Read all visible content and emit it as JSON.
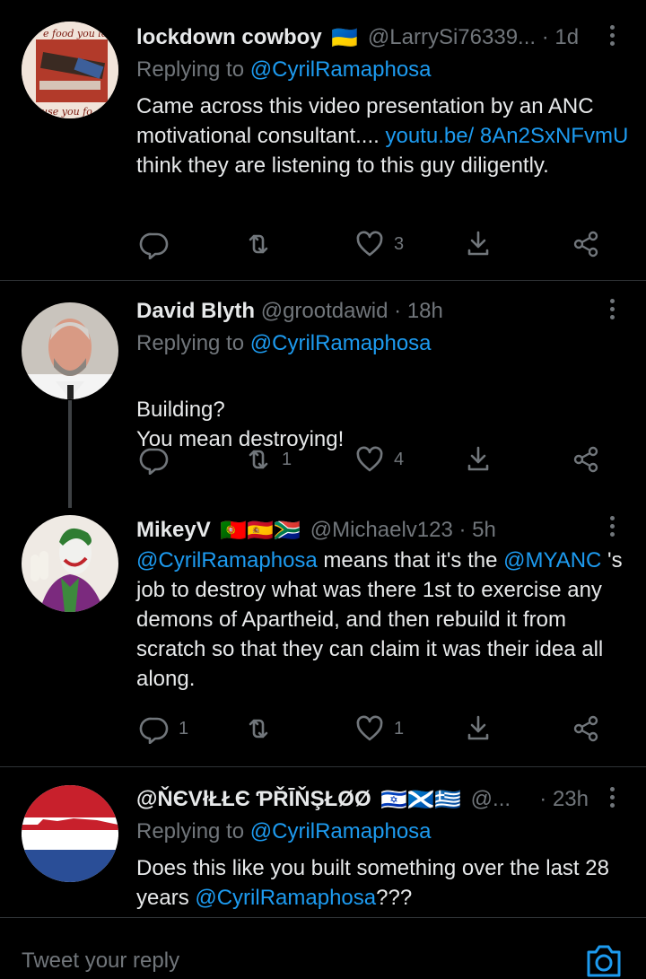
{
  "tweets": [
    {
      "name": "lockdown cowboy",
      "flags": "🇺🇦",
      "handle": "@LarrySi76339...",
      "time": "· 1d",
      "reply_prefix": "Replying to",
      "reply_to": "@CyrilRamaphosa",
      "text": [
        {
          "t": "Came across this video presentation by an ANC motivational consultant.... ",
          "link": false
        },
        {
          "t": "youtu.be/ 8An2SxNFvmU",
          "link": true
        },
        {
          "t": " think they are listening to this guy diligently.",
          "link": false
        }
      ],
      "replies": "",
      "retweets": "",
      "likes": "3"
    },
    {
      "name": "David Blyth",
      "flags": "",
      "handle": "@grootdawid",
      "time": "· 18h",
      "reply_prefix": "Replying to",
      "reply_to": "@CyrilRamaphosa",
      "text": [
        {
          "t": "Building?\nYou mean destroying!",
          "link": false
        }
      ],
      "replies": "",
      "retweets": "1",
      "likes": "4"
    },
    {
      "name": "MikeyV",
      "flags": "🇵🇹🇪🇸🇿🇦",
      "handle": "@Michaelv123",
      "time": "· 5h",
      "reply_prefix": "",
      "reply_to": "",
      "text": [
        {
          "t": "@CyrilRamaphosa",
          "link": true
        },
        {
          "t": " means that it's the ",
          "link": false
        },
        {
          "t": "@MYANC",
          "link": true
        },
        {
          "t": " 's job to destroy what was there 1st to exercise any demons of Apartheid, and then rebuild it from scratch so that they can claim it was their idea all along.",
          "link": false
        }
      ],
      "replies": "1",
      "retweets": "",
      "likes": "1"
    },
    {
      "name": "@ŇЄVłŁŁЄ ƤŘĪŇŞŁØØ",
      "flags": "🇮🇱🏴󠁧󠁢󠁳󠁣󠁴󠁿🇬🇷",
      "handle": "@...",
      "time": "· 23h",
      "reply_prefix": "Replying to",
      "reply_to": "@CyrilRamaphosa",
      "text": [
        {
          "t": "Does this like you built something over the last 28 years ",
          "link": false
        },
        {
          "t": "@CyrilRamaphosa",
          "link": true
        },
        {
          "t": "???",
          "link": false
        }
      ],
      "replies": "",
      "retweets": "",
      "likes": ""
    }
  ],
  "avatar_text": {
    "top": "e food you lo",
    "bottom": "use you fo"
  },
  "reply_bar": {
    "placeholder": "Tweet your reply"
  },
  "icons": {
    "reply": "reply-icon",
    "retweet": "retweet-icon",
    "like": "heart-icon",
    "download": "download-icon",
    "share": "share-icon",
    "more": "more-icon",
    "camera": "camera-icon"
  },
  "colors": {
    "background": "#000000",
    "link": "#1d9bf0",
    "muted": "#71767b",
    "text": "#e7e9ea",
    "divider": "#2f3336"
  }
}
